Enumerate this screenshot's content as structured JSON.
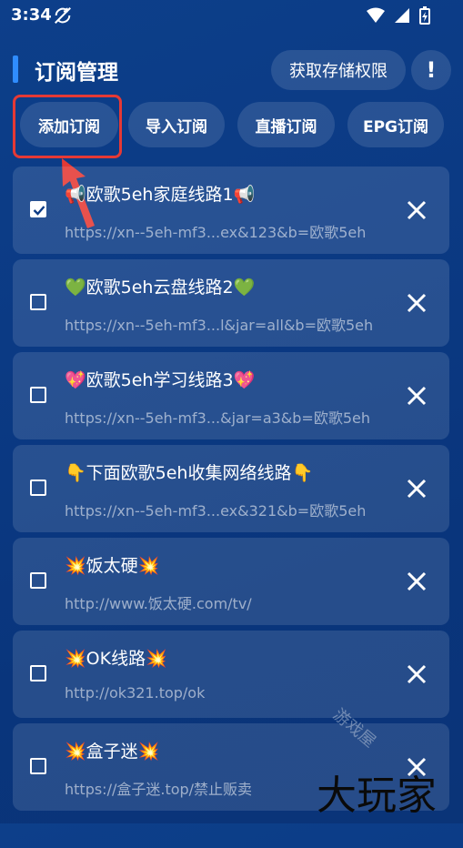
{
  "status": {
    "time": "3:34"
  },
  "header": {
    "title": "订阅管理",
    "perm_button": "获取存储权限",
    "info_button": "!"
  },
  "tabs": [
    {
      "label": "添加订阅"
    },
    {
      "label": "导入订阅"
    },
    {
      "label": "直播订阅"
    },
    {
      "label": "EPG订阅"
    }
  ],
  "items": [
    {
      "name": "📢欧歌5eh家庭线路1📢",
      "url": "https://xn--5eh-mf3...ex&123&b=欧歌5eh",
      "checked": true
    },
    {
      "name": "💚欧歌5eh云盘线路2💚",
      "url": "https://xn--5eh-mf3...l&jar=all&b=欧歌5eh",
      "checked": false
    },
    {
      "name": "💖欧歌5eh学习线路3💖",
      "url": "https://xn--5eh-mf3...&jar=a3&b=欧歌5eh",
      "checked": false
    },
    {
      "name": "👇下面欧歌5eh收集网络线路👇",
      "url": "https://xn--5eh-mf3...ex&321&b=欧歌5eh",
      "checked": false
    },
    {
      "name": "💥饭太硬💥",
      "url": "http://www.饭太硬.com/tv/",
      "checked": false
    },
    {
      "name": "💥OK线路💥",
      "url": "http://ok321.top/ok",
      "checked": false
    },
    {
      "name": "💥盒子迷💥",
      "url": "https://盒子迷.top/禁止贩卖",
      "checked": false
    }
  ],
  "watermark": {
    "main": "大玩家",
    "arc": "游戏屋"
  },
  "colors": {
    "accent": "#2f8cff",
    "highlight": "#e53935"
  }
}
